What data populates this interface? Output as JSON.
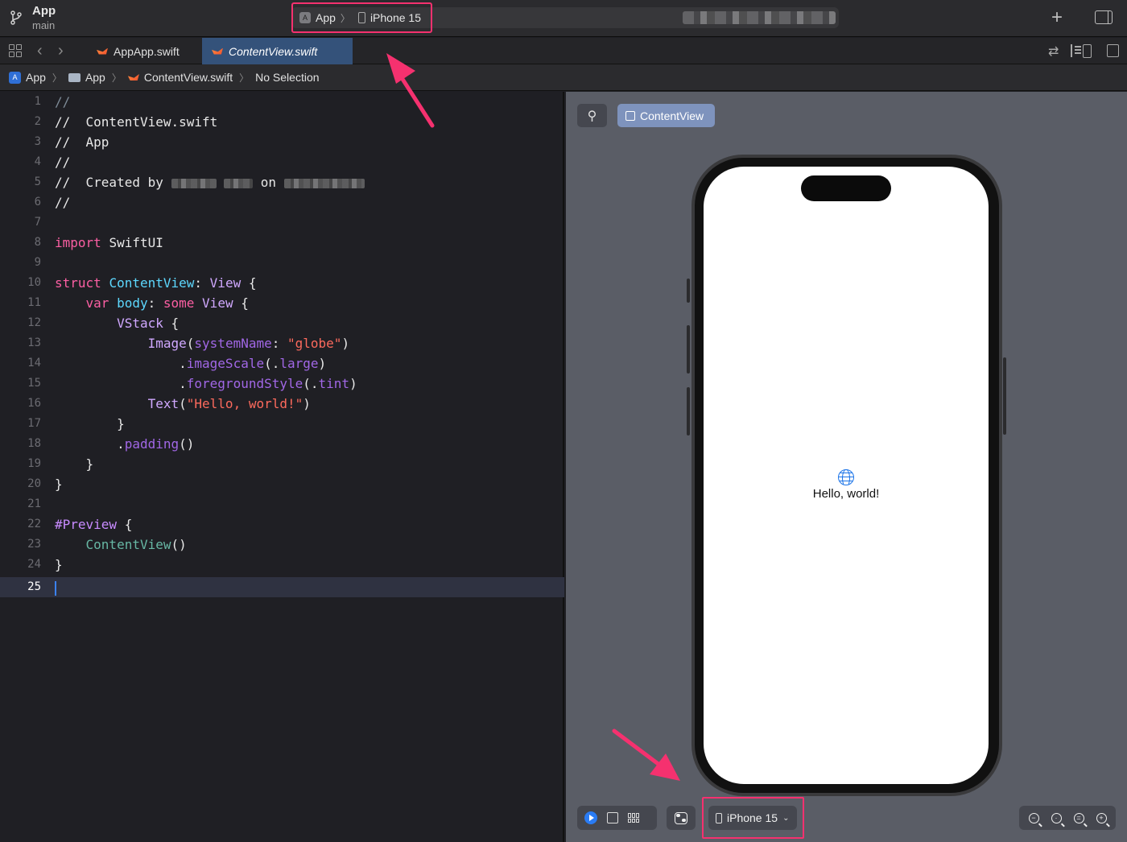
{
  "toolbar": {
    "project_name": "App",
    "branch": "main",
    "scheme_app": "App",
    "scheme_chevron": "〉",
    "scheme_device": "iPhone 15",
    "add_icon": "plus-icon",
    "inspector_icon": "sidebar-right-icon"
  },
  "tabs": [
    {
      "label": "AppApp.swift",
      "active": false
    },
    {
      "label": "ContentView.swift",
      "active": true
    }
  ],
  "jumpbar": {
    "items": [
      "App",
      "App",
      "ContentView.swift",
      "No Selection"
    ],
    "separator": "〉"
  },
  "editor": {
    "current_line": 25,
    "line_numbers": [
      "1",
      "2",
      "3",
      "4",
      "5",
      "6",
      "7",
      "8",
      "9",
      "10",
      "11",
      "12",
      "13",
      "14",
      "15",
      "16",
      "17",
      "18",
      "19",
      "20",
      "21",
      "22",
      "23",
      "24",
      "25"
    ],
    "tokens": {
      "comment": "//",
      "file_name": "ContentView.swift",
      "project": "App",
      "created_by": "Created by",
      "on": "on",
      "import": "import",
      "swiftui": "SwiftUI",
      "struct": "struct",
      "content_view": "ContentView",
      "view": "View",
      "var": "var",
      "body": "body",
      "some": "some",
      "vstack": "VStack",
      "image": "Image",
      "system_name": "systemName",
      "globe_str": "\"globe\"",
      "image_scale": "imageScale",
      "large": "large",
      "foreground_style": "foregroundStyle",
      "tint": "tint",
      "text": "Text",
      "hello_str": "\"Hello, world!\"",
      "padding": "padding",
      "preview": "#Preview",
      "content_view_call": "ContentView"
    }
  },
  "canvas": {
    "pin_icon": "pin-icon",
    "preview_button": "ContentView",
    "preview_text": "Hello, world!",
    "preview_icon": "globe-icon",
    "device_label": "iPhone 15",
    "device_chevron": "⌄"
  },
  "colors": {
    "highlight": "#f5316f",
    "active_tab": "#34527a",
    "accent": "#2a7cf5"
  }
}
